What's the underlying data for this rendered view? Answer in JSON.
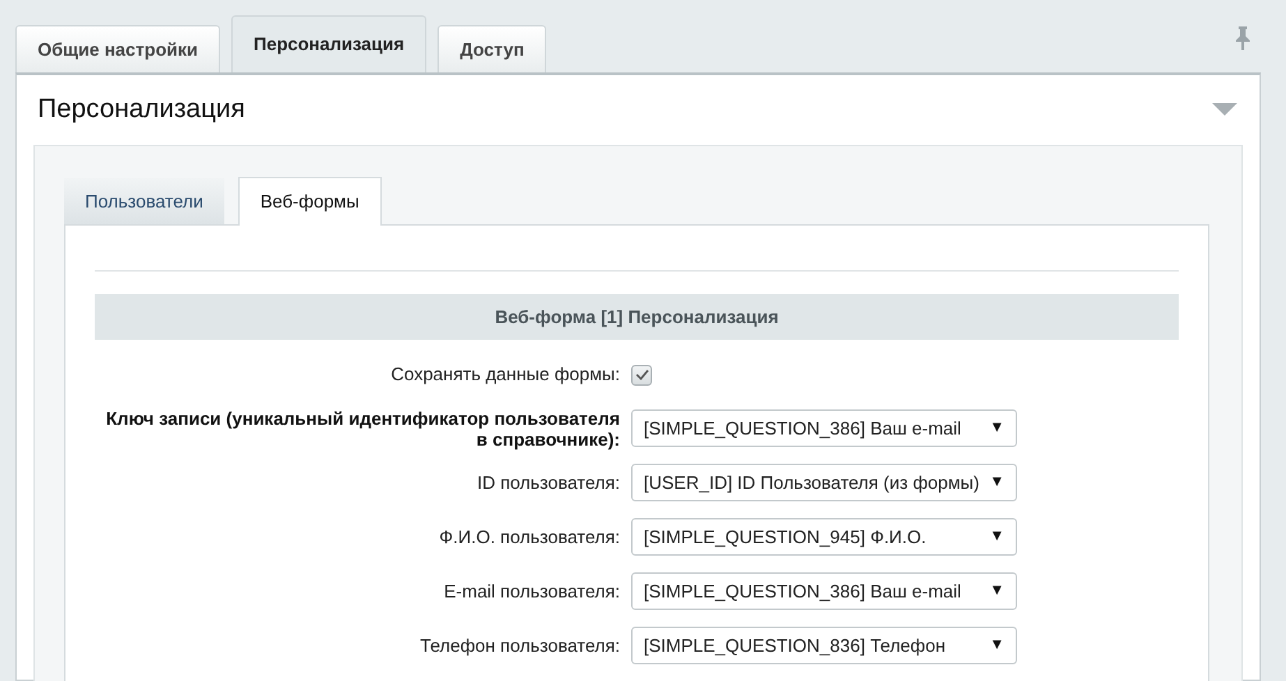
{
  "top_tabs": [
    {
      "label": "Общие настройки",
      "selected": false
    },
    {
      "label": "Персонализация",
      "selected": true
    },
    {
      "label": "Доступ",
      "selected": false
    }
  ],
  "panel": {
    "title": "Персонализация",
    "expanded": true
  },
  "inner_tabs": [
    {
      "label": "Пользователи",
      "selected": false
    },
    {
      "label": "Веб-формы",
      "selected": true
    }
  ],
  "section": {
    "title": "Веб-форма [1] Персонализация"
  },
  "fields": [
    {
      "kind": "checkbox",
      "label": "Сохранять данные формы:",
      "bold": false,
      "checked": true
    },
    {
      "kind": "select",
      "label": "Ключ записи (уникальный идентификатор пользователя в справочнике):",
      "bold": true,
      "value": "[SIMPLE_QUESTION_386] Ваш e-mail",
      "arrow": "▼"
    },
    {
      "kind": "select",
      "label": "ID пользователя:",
      "bold": false,
      "value": "[USER_ID] ID Пользователя (из формы)",
      "arrow": "▼"
    },
    {
      "kind": "select",
      "label": "Ф.И.О. пользователя:",
      "bold": false,
      "value": "[SIMPLE_QUESTION_945] Ф.И.О.",
      "arrow": "▼"
    },
    {
      "kind": "select",
      "label": "E-mail пользователя:",
      "bold": false,
      "value": "[SIMPLE_QUESTION_386] Ваш e-mail",
      "arrow": "▼"
    },
    {
      "kind": "select",
      "label": "Телефон пользователя:",
      "bold": false,
      "value": "[SIMPLE_QUESTION_836] Телефон",
      "arrow": "▼"
    }
  ]
}
